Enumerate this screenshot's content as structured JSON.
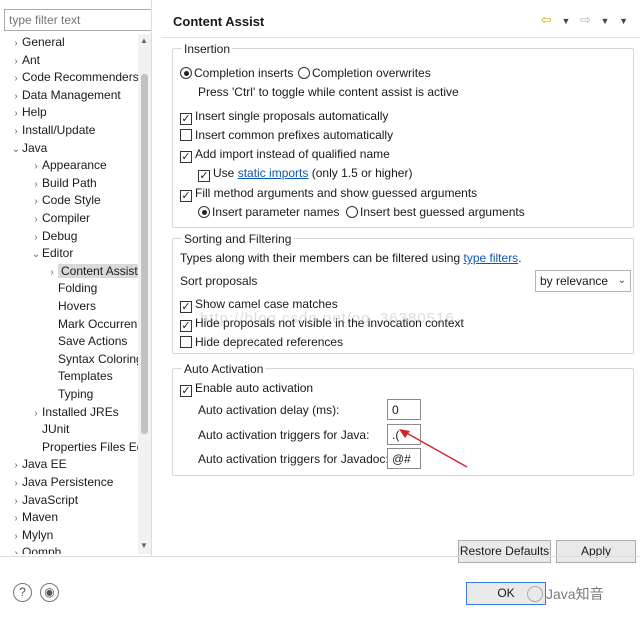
{
  "filter": {
    "placeholder": "type filter text"
  },
  "tree": [
    {
      "label": "General",
      "arrow": "›",
      "level": 0
    },
    {
      "label": "Ant",
      "arrow": "›",
      "level": 0
    },
    {
      "label": "Code Recommenders",
      "arrow": "›",
      "level": 0
    },
    {
      "label": "Data Management",
      "arrow": "›",
      "level": 0
    },
    {
      "label": "Help",
      "arrow": "›",
      "level": 0
    },
    {
      "label": "Install/Update",
      "arrow": "›",
      "level": 0
    },
    {
      "label": "Java",
      "arrow": "⌄",
      "level": 0
    },
    {
      "label": "Appearance",
      "arrow": "›",
      "level": 1
    },
    {
      "label": "Build Path",
      "arrow": "›",
      "level": 1
    },
    {
      "label": "Code Style",
      "arrow": "›",
      "level": 1
    },
    {
      "label": "Compiler",
      "arrow": "›",
      "level": 1
    },
    {
      "label": "Debug",
      "arrow": "›",
      "level": 1
    },
    {
      "label": "Editor",
      "arrow": "⌄",
      "level": 1
    },
    {
      "label": "Content Assist",
      "arrow": "›",
      "level": 2,
      "selected": true
    },
    {
      "label": "Folding",
      "arrow": "",
      "level": 2
    },
    {
      "label": "Hovers",
      "arrow": "",
      "level": 2
    },
    {
      "label": "Mark Occurren",
      "arrow": "",
      "level": 2
    },
    {
      "label": "Save Actions",
      "arrow": "",
      "level": 2
    },
    {
      "label": "Syntax Coloring",
      "arrow": "",
      "level": 2
    },
    {
      "label": "Templates",
      "arrow": "",
      "level": 2
    },
    {
      "label": "Typing",
      "arrow": "",
      "level": 2
    },
    {
      "label": "Installed JREs",
      "arrow": "›",
      "level": 1
    },
    {
      "label": "JUnit",
      "arrow": "",
      "level": 1
    },
    {
      "label": "Properties Files Ed",
      "arrow": "",
      "level": 1
    },
    {
      "label": "Java EE",
      "arrow": "›",
      "level": 0
    },
    {
      "label": "Java Persistence",
      "arrow": "›",
      "level": 0
    },
    {
      "label": "JavaScript",
      "arrow": "›",
      "level": 0
    },
    {
      "label": "Maven",
      "arrow": "›",
      "level": 0
    },
    {
      "label": "Mylyn",
      "arrow": "›",
      "level": 0
    },
    {
      "label": "Oomph",
      "arrow": "›",
      "level": 0
    }
  ],
  "header": {
    "title": "Content Assist"
  },
  "insertion": {
    "title": "Insertion",
    "completion_inserts": "Completion inserts",
    "completion_overwrites": "Completion overwrites",
    "hint": "Press 'Ctrl' to toggle while content assist is active",
    "insert_single": "Insert single proposals automatically",
    "insert_common": "Insert common prefixes automatically",
    "add_import": "Add import instead of qualified name",
    "use": "Use",
    "static_imports": "static imports",
    "only": "(only 1.5 or higher)",
    "fill_method": "Fill method arguments and show guessed arguments",
    "insert_param": "Insert parameter names",
    "insert_best": "Insert best guessed arguments"
  },
  "sorting": {
    "title": "Sorting and Filtering",
    "types_along": "Types along with their members can be filtered using",
    "type_filters": "type filters",
    "period": ".",
    "sort_proposals": "Sort proposals",
    "sort_value": "by relevance",
    "camel_case": "Show camel case matches",
    "hide_not_visible": "Hide proposals not visible in the invocation context",
    "hide_deprecated": "Hide deprecated references"
  },
  "auto_activation": {
    "title": "Auto Activation",
    "enable": "Enable auto activation",
    "delay_label": "Auto activation delay (ms):",
    "delay_value": "0",
    "java_label": "Auto activation triggers for Java:",
    "java_value": ".(",
    "javadoc_label": "Auto activation triggers for Javadoc:",
    "javadoc_value": "@#"
  },
  "buttons": {
    "restore_defaults": "Restore Defaults",
    "apply": "Apply",
    "ok": "OK"
  },
  "footer": {
    "watermark": "Java知音"
  },
  "annotation_color": "#d0232a"
}
